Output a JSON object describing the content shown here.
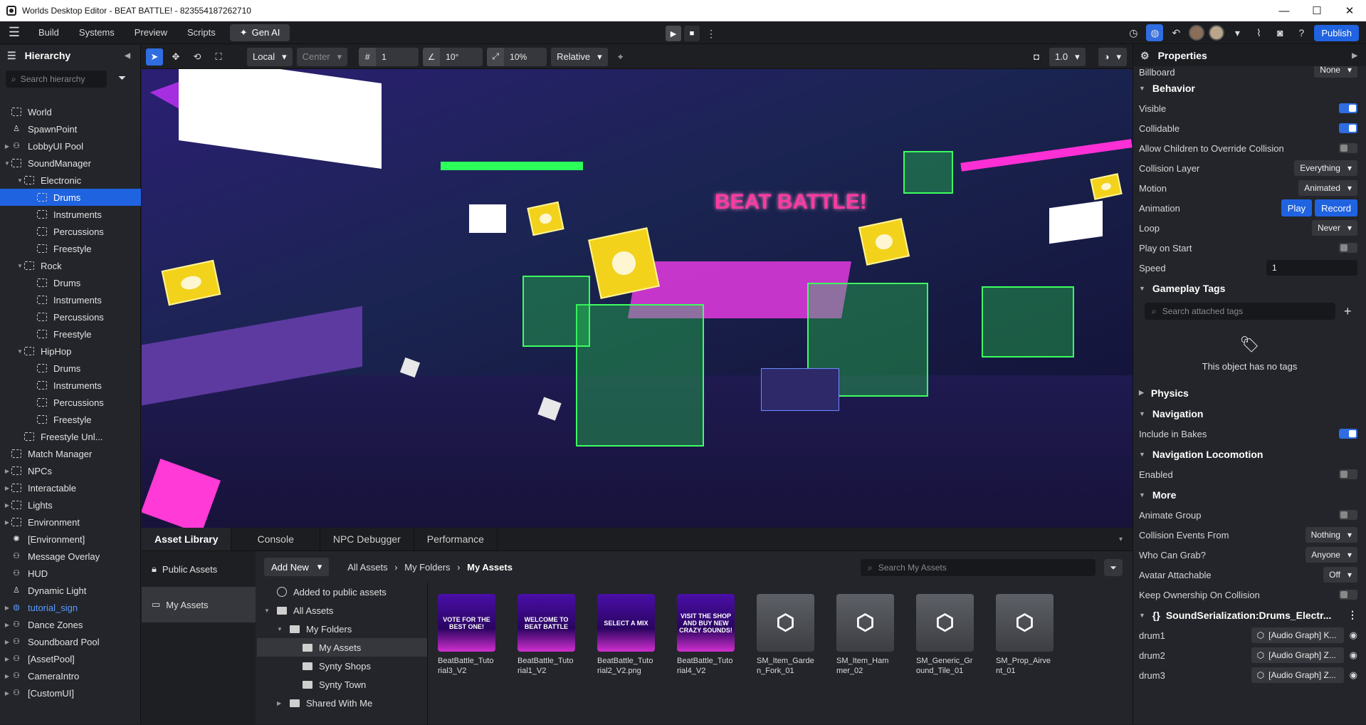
{
  "window": {
    "title": "Worlds Desktop Editor - BEAT BATTLE! - 823554187262710"
  },
  "menu": {
    "items": [
      "Build",
      "Systems",
      "Preview",
      "Scripts"
    ],
    "genai": "Gen AI",
    "publish": "Publish"
  },
  "hierarchy": {
    "title": "Hierarchy",
    "search_placeholder": "Search hierarchy",
    "items": [
      {
        "label": "World",
        "depth": 0,
        "icon": "dashed",
        "arrow": ""
      },
      {
        "label": "SpawnPoint",
        "depth": 0,
        "icon": "person",
        "arrow": ""
      },
      {
        "label": "LobbyUI Pool",
        "depth": 0,
        "icon": "group",
        "arrow": "▶"
      },
      {
        "label": "SoundManager",
        "depth": 0,
        "icon": "dashed",
        "arrow": "▼"
      },
      {
        "label": "Electronic",
        "depth": 1,
        "icon": "dashed",
        "arrow": "▼"
      },
      {
        "label": "Drums",
        "depth": 2,
        "icon": "dashed",
        "arrow": "",
        "selected": true
      },
      {
        "label": "Instruments",
        "depth": 2,
        "icon": "dashed",
        "arrow": ""
      },
      {
        "label": "Percussions",
        "depth": 2,
        "icon": "dashed",
        "arrow": ""
      },
      {
        "label": "Freestyle",
        "depth": 2,
        "icon": "dashed",
        "arrow": ""
      },
      {
        "label": "Rock",
        "depth": 1,
        "icon": "dashed",
        "arrow": "▼"
      },
      {
        "label": "Drums",
        "depth": 2,
        "icon": "dashed",
        "arrow": ""
      },
      {
        "label": "Instruments",
        "depth": 2,
        "icon": "dashed",
        "arrow": ""
      },
      {
        "label": "Percussions",
        "depth": 2,
        "icon": "dashed",
        "arrow": ""
      },
      {
        "label": "Freestyle",
        "depth": 2,
        "icon": "dashed",
        "arrow": ""
      },
      {
        "label": "HipHop",
        "depth": 1,
        "icon": "dashed",
        "arrow": "▼"
      },
      {
        "label": "Drums",
        "depth": 2,
        "icon": "dashed",
        "arrow": ""
      },
      {
        "label": "Instruments",
        "depth": 2,
        "icon": "dashed",
        "arrow": ""
      },
      {
        "label": "Percussions",
        "depth": 2,
        "icon": "dashed",
        "arrow": ""
      },
      {
        "label": "Freestyle",
        "depth": 2,
        "icon": "dashed",
        "arrow": ""
      },
      {
        "label": "Freestyle Unl...",
        "depth": 1,
        "icon": "dashed",
        "arrow": ""
      },
      {
        "label": "Match Manager",
        "depth": 0,
        "icon": "dashed",
        "arrow": ""
      },
      {
        "label": "NPCs",
        "depth": 0,
        "icon": "dashed",
        "arrow": "▶"
      },
      {
        "label": "Interactable",
        "depth": 0,
        "icon": "dashed",
        "arrow": "▶"
      },
      {
        "label": "Lights",
        "depth": 0,
        "icon": "dashed",
        "arrow": "▶"
      },
      {
        "label": "Environment",
        "depth": 0,
        "icon": "dashed",
        "arrow": "▶"
      },
      {
        "label": "[Environment]",
        "depth": 0,
        "icon": "gear",
        "arrow": ""
      },
      {
        "label": "Message Overlay",
        "depth": 0,
        "icon": "group",
        "arrow": ""
      },
      {
        "label": "HUD",
        "depth": 0,
        "icon": "group",
        "arrow": ""
      },
      {
        "label": "Dynamic Light",
        "depth": 0,
        "icon": "person",
        "arrow": ""
      },
      {
        "label": "tutorial_sign",
        "depth": 0,
        "icon": "globe",
        "arrow": "▶",
        "blue": true
      },
      {
        "label": "Dance Zones",
        "depth": 0,
        "icon": "group",
        "arrow": "▶"
      },
      {
        "label": "Soundboard Pool",
        "depth": 0,
        "icon": "group",
        "arrow": "▶"
      },
      {
        "label": "[AssetPool]",
        "depth": 0,
        "icon": "group",
        "arrow": "▶"
      },
      {
        "label": "CameraIntro",
        "depth": 0,
        "icon": "group",
        "arrow": "▶"
      },
      {
        "label": "[CustomUI]",
        "depth": 0,
        "icon": "group",
        "arrow": "▶"
      }
    ]
  },
  "toolbar": {
    "space": "Local",
    "pivot": "Center",
    "grid": "1",
    "angle": "10°",
    "scale": "10%",
    "mode": "Relative",
    "camera_speed": "1.0"
  },
  "viewport": {
    "sign_text": "BEAT BATTLE!"
  },
  "bottom": {
    "tabs": [
      "Asset Library",
      "Console",
      "NPC Debugger",
      "Performance"
    ],
    "nav": [
      "Public Assets",
      "My Assets"
    ],
    "add_new": "Add New",
    "crumbs": [
      "All Assets",
      "My Folders",
      "My Assets"
    ],
    "search_placeholder": "Search My Assets",
    "folders": [
      {
        "label": "Added to public assets",
        "depth": 0,
        "arrow": ""
      },
      {
        "label": "All Assets",
        "depth": 0,
        "arrow": "▼"
      },
      {
        "label": "My Folders",
        "depth": 1,
        "arrow": "▼"
      },
      {
        "label": "My Assets",
        "depth": 2,
        "arrow": "",
        "active": true
      },
      {
        "label": "Synty Shops",
        "depth": 2,
        "arrow": ""
      },
      {
        "label": "Synty Town",
        "depth": 2,
        "arrow": ""
      },
      {
        "label": "Shared With Me",
        "depth": 1,
        "arrow": "▶"
      }
    ],
    "assets": [
      {
        "name": "BeatBattle_Tutorial3_V2",
        "kind": "img",
        "caption": "VOTE FOR THE BEST ONE!"
      },
      {
        "name": "BeatBattle_Tutorial1_V2",
        "kind": "img",
        "caption": "WELCOME TO BEAT BATTLE"
      },
      {
        "name": "BeatBattle_Tutorial2_V2.png",
        "kind": "img",
        "caption": "SELECT A MIX"
      },
      {
        "name": "BeatBattle_Tutorial4_V2",
        "kind": "img",
        "caption": "VISIT THE SHOP AND BUY NEW CRAZY SOUNDS!"
      },
      {
        "name": "SM_Item_Garden_Fork_01",
        "kind": "box"
      },
      {
        "name": "SM_Item_Hammer_02",
        "kind": "box"
      },
      {
        "name": "SM_Generic_Ground_Tile_01",
        "kind": "box"
      },
      {
        "name": "SM_Prop_Airvent_01",
        "kind": "box"
      }
    ]
  },
  "properties": {
    "title": "Properties",
    "billboard": {
      "label": "Billboard",
      "value": "None"
    },
    "behavior": {
      "title": "Behavior",
      "visible": "Visible",
      "collidable": "Collidable",
      "allow_children": "Allow Children to Override Collision",
      "collision_layer": {
        "label": "Collision Layer",
        "value": "Everything"
      },
      "motion": {
        "label": "Motion",
        "value": "Animated"
      },
      "animation": {
        "label": "Animation",
        "play": "Play",
        "record": "Record"
      },
      "loop": {
        "label": "Loop",
        "value": "Never"
      },
      "play_on_start": "Play on Start",
      "speed": {
        "label": "Speed",
        "value": "1"
      }
    },
    "gameplay_tags": {
      "title": "Gameplay Tags",
      "placeholder": "Search attached tags",
      "empty": "This object has no tags"
    },
    "physics": {
      "title": "Physics"
    },
    "navigation": {
      "title": "Navigation",
      "include": "Include in Bakes"
    },
    "nav_loco": {
      "title": "Navigation Locomotion",
      "enabled": "Enabled"
    },
    "more": {
      "title": "More",
      "animate_group": "Animate Group",
      "collision_events": {
        "label": "Collision Events From",
        "value": "Nothing"
      },
      "who_can_grab": {
        "label": "Who Can Grab?",
        "value": "Anyone"
      },
      "avatar_attachable": {
        "label": "Avatar Attachable",
        "value": "Off"
      },
      "keep_ownership": "Keep Ownership On Collision"
    },
    "script": {
      "title": "SoundSerialization:Drums_Electr...",
      "rows": [
        {
          "label": "drum1",
          "value": "[Audio Graph] K..."
        },
        {
          "label": "drum2",
          "value": "[Audio Graph] Z..."
        },
        {
          "label": "drum3",
          "value": "[Audio Graph] Z..."
        }
      ]
    }
  }
}
